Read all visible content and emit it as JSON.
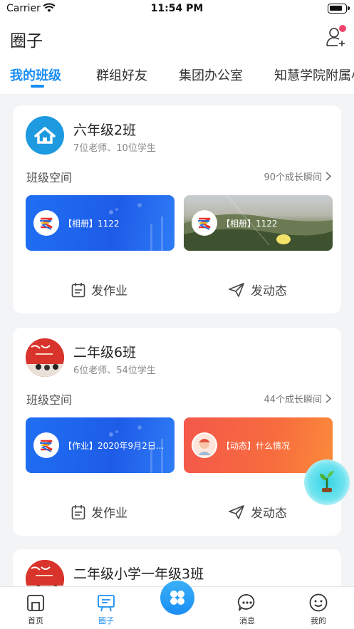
{
  "status_bar": {
    "carrier": "Carrier",
    "time": "11:54 PM"
  },
  "header": {
    "title": "圈子"
  },
  "tabs": [
    {
      "label": "我的班级"
    },
    {
      "label": "群组好友"
    },
    {
      "label": "集团办公室"
    },
    {
      "label": "知慧学院附属小"
    }
  ],
  "classes": [
    {
      "name": "六年级2班",
      "counts": "7位老师、10位学生",
      "space_label": "班级空间",
      "moments": "90个成长瞬间",
      "tiles": [
        {
          "text": "【相册】1122"
        },
        {
          "text": "【相册】1122"
        }
      ],
      "actions": {
        "homework": "发作业",
        "post": "发动态"
      }
    },
    {
      "name": "二年级6班",
      "counts": "6位老师、54位学生",
      "space_label": "班级空间",
      "moments": "44个成长瞬间",
      "tiles": [
        {
          "text": "【作业】2020年9月2日..."
        },
        {
          "text": "【动态】什么情况"
        }
      ],
      "actions": {
        "homework": "发作业",
        "post": "发动态"
      }
    },
    {
      "name": "二年级小学一年级3班"
    }
  ],
  "tabbar": [
    {
      "label": "首页"
    },
    {
      "label": "圈子"
    },
    {
      "label": "消息"
    },
    {
      "label": "我的"
    }
  ],
  "colors": {
    "accent": "#1a8ef5",
    "badge": "#f0446d"
  }
}
